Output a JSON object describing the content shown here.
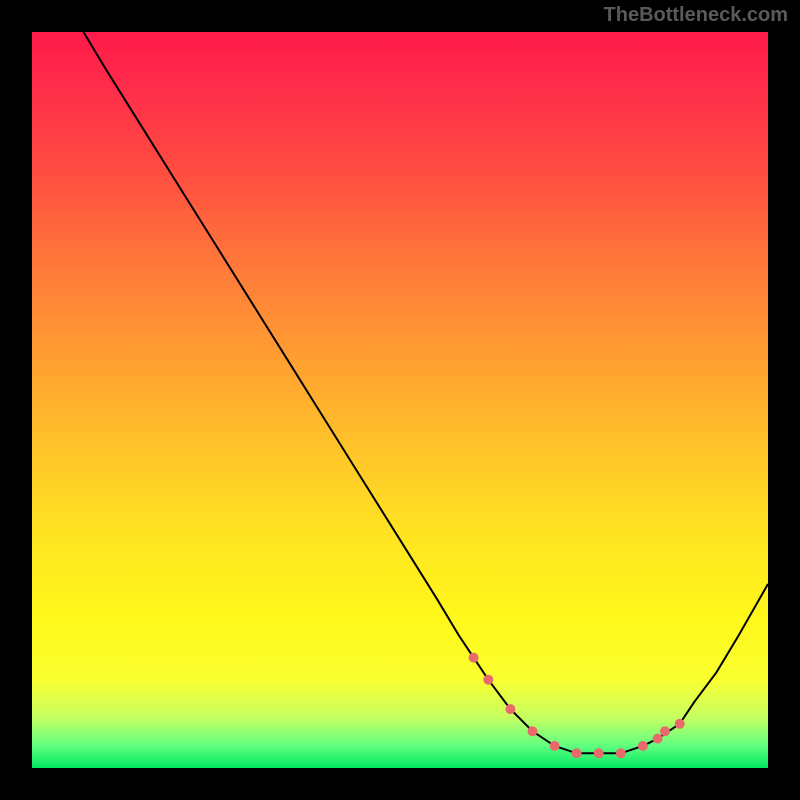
{
  "watermark": "TheBottleneck.com",
  "chart_data": {
    "type": "line",
    "title": "",
    "xlabel": "",
    "ylabel": "",
    "xlim": [
      0,
      100
    ],
    "ylim": [
      0,
      100
    ],
    "series": [
      {
        "name": "bottleneck-curve",
        "x": [
          7,
          10,
          15,
          20,
          25,
          30,
          35,
          40,
          45,
          50,
          55,
          58,
          60,
          62,
          65,
          68,
          71,
          74,
          77,
          80,
          83,
          85,
          88,
          90,
          93,
          96,
          100
        ],
        "y": [
          100,
          95,
          87,
          79,
          71,
          63,
          55,
          47,
          39,
          31,
          23,
          18,
          15,
          12,
          8,
          5,
          3,
          2,
          2,
          2,
          3,
          4,
          6,
          9,
          13,
          18,
          25
        ]
      }
    ],
    "highlight_dots": {
      "name": "optimal-range",
      "x": [
        60,
        62,
        65,
        68,
        71,
        74,
        77,
        80,
        83,
        85,
        86,
        88
      ],
      "y": [
        15,
        12,
        8,
        5,
        3,
        2,
        2,
        2,
        3,
        4,
        5,
        6
      ]
    },
    "gradient": {
      "top": "#ff1a4a",
      "mid": "#ffe820",
      "bottom": "#00e860"
    }
  }
}
